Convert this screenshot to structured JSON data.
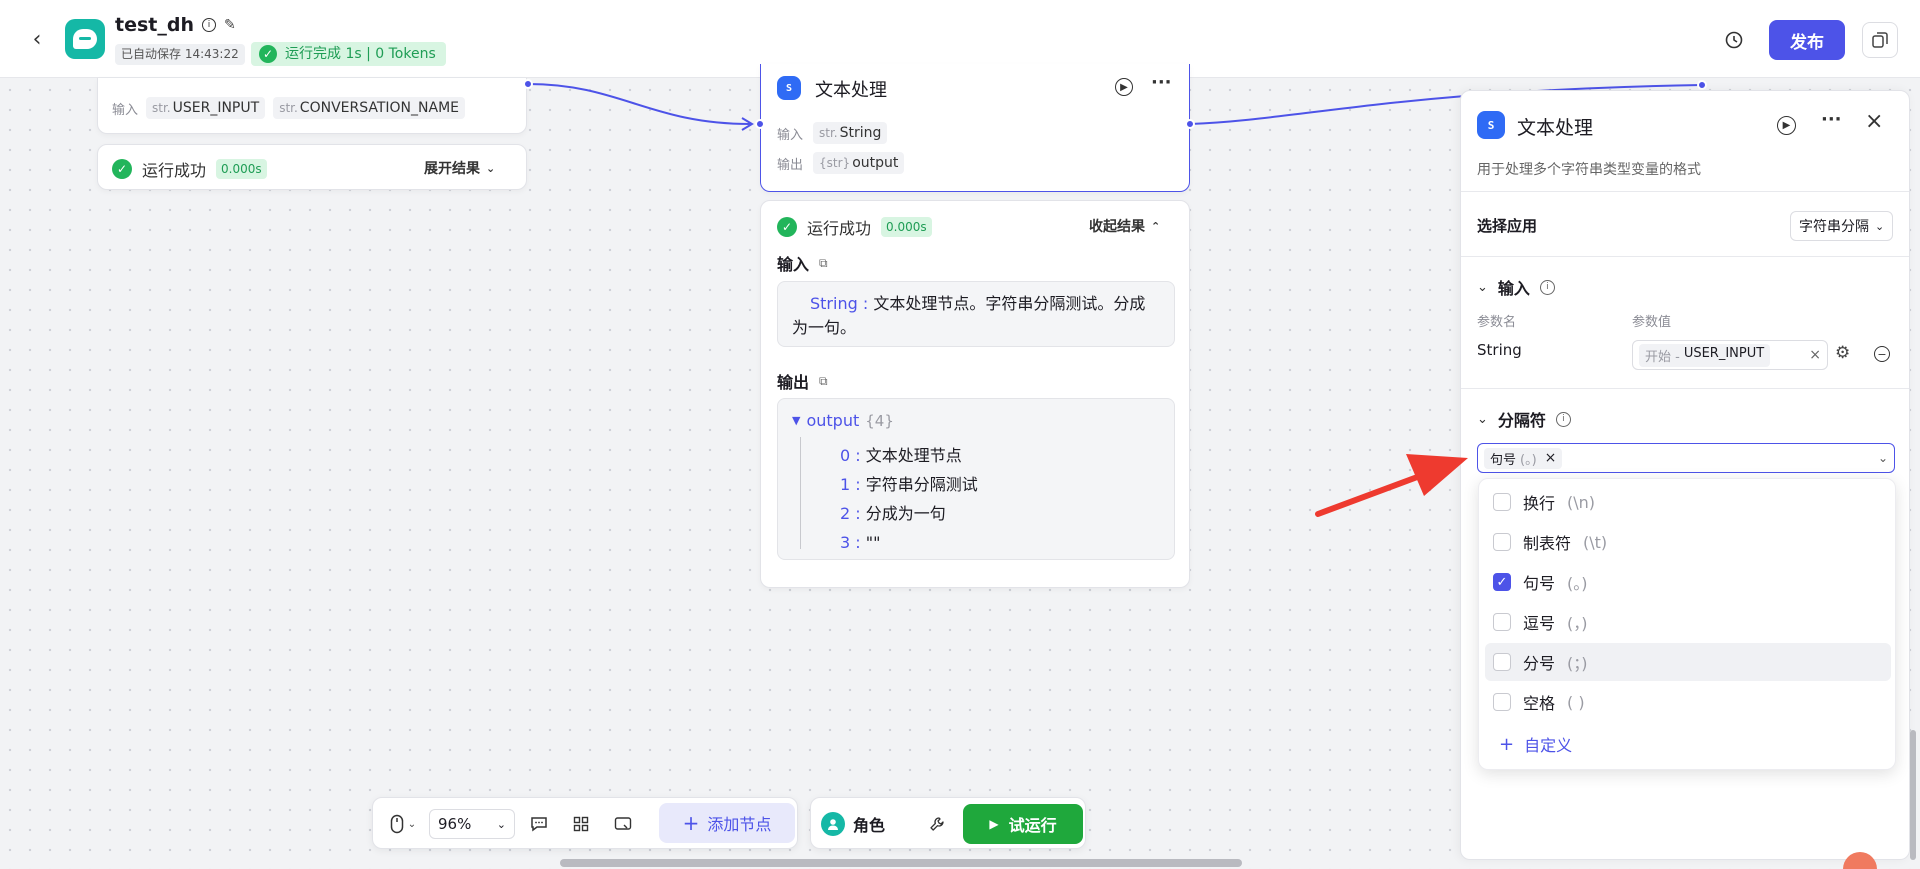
{
  "header": {
    "app_name": "test_dh",
    "autosave": "已自动保存 14:43:22",
    "run_status": "运行完成 1s | 0 Tokens",
    "publish_label": "发布"
  },
  "start_node": {
    "input_label": "输入",
    "vars": [
      {
        "type": "str.",
        "name": "USER_INPUT"
      },
      {
        "type": "str.",
        "name": "CONVERSATION_NAME"
      }
    ],
    "result_status": "运行成功",
    "result_time": "0.000s",
    "expand_label": "展开结果"
  },
  "text_node": {
    "title": "文本处理",
    "input_label": "输入",
    "input_type": "str.",
    "input_name": "String",
    "output_label": "输出",
    "output_type": "{str}",
    "output_name": "output",
    "result_status": "运行成功",
    "result_time": "0.000s",
    "collapse_label": "收起结果",
    "input_section_title": "输入",
    "input_key": "String :",
    "input_value": "文本处理节点。字符串分隔测试。分成为一句。",
    "output_section_title": "输出",
    "output_root": "output",
    "output_count": "{4}",
    "output_items": [
      {
        "index": "0 :",
        "value": "文本处理节点"
      },
      {
        "index": "1 :",
        "value": "字符串分隔测试"
      },
      {
        "index": "2 :",
        "value": "分成为一句"
      },
      {
        "index": "3 :",
        "value": "\"\""
      }
    ]
  },
  "panel": {
    "title": "文本处理",
    "description": "用于处理多个字符串类型变量的格式",
    "select_app_label": "选择应用",
    "select_app_value": "字符串分隔",
    "input_section": "输入",
    "param_name_header": "参数名",
    "param_value_header": "参数值",
    "param_name": "String",
    "param_value_prefix": "开始 -",
    "param_value": "USER_INPUT",
    "separator_section": "分隔符",
    "selected_chip": "句号",
    "selected_chip_symbol": "(。)",
    "options": [
      {
        "label": "换行",
        "symbol": "(\\n)",
        "checked": false
      },
      {
        "label": "制表符",
        "symbol": "(\\t)",
        "checked": false
      },
      {
        "label": "句号",
        "symbol": "(。)",
        "checked": true
      },
      {
        "label": "逗号",
        "symbol": "(，)",
        "checked": false
      },
      {
        "label": "分号",
        "symbol": "(；)",
        "checked": false
      },
      {
        "label": "空格",
        "symbol": "( )",
        "checked": false
      }
    ],
    "custom_label": "自定义"
  },
  "toolbar": {
    "zoom": "96%",
    "add_node_label": "添加节点",
    "role_label": "角色",
    "test_run_label": "试运行"
  },
  "colors": {
    "accent": "#4d53e8",
    "success": "#22b55b",
    "run_button": "#1fa83c",
    "annotation_arrow": "#ee3a2f"
  }
}
